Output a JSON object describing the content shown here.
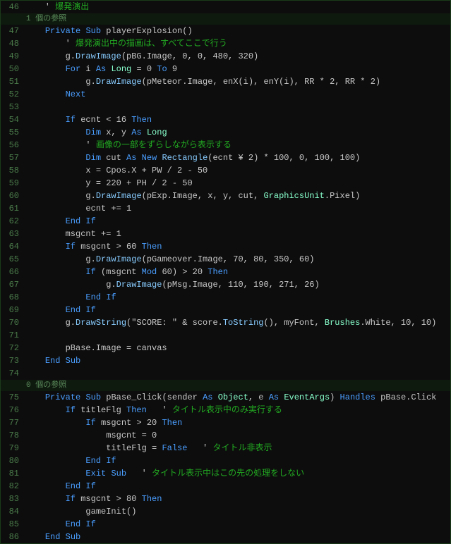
{
  "lines": [
    {
      "num": "46",
      "type": "code",
      "tokens": [
        {
          "t": "    ' ",
          "c": "plain"
        },
        {
          "t": "爆発演出",
          "c": "comment"
        }
      ]
    },
    {
      "num": "",
      "type": "ref",
      "text": "1 個の参照"
    },
    {
      "num": "47",
      "type": "code",
      "tokens": [
        {
          "t": "    ",
          "c": "plain"
        },
        {
          "t": "Private",
          "c": "kw"
        },
        {
          "t": " ",
          "c": "plain"
        },
        {
          "t": "Sub",
          "c": "kw"
        },
        {
          "t": " playerExplosion()",
          "c": "plain"
        }
      ]
    },
    {
      "num": "48",
      "type": "code",
      "tokens": [
        {
          "t": "        ' ",
          "c": "plain"
        },
        {
          "t": "爆発演出中の描画は、すべてここで行う",
          "c": "comment"
        }
      ]
    },
    {
      "num": "49",
      "type": "code",
      "tokens": [
        {
          "t": "        g.",
          "c": "plain"
        },
        {
          "t": "DrawImage",
          "c": "func"
        },
        {
          "t": "(pBG.Image, 0, 0, 480, 320)",
          "c": "plain"
        }
      ]
    },
    {
      "num": "50",
      "type": "code",
      "tokens": [
        {
          "t": "        ",
          "c": "plain"
        },
        {
          "t": "For",
          "c": "kw"
        },
        {
          "t": " i ",
          "c": "plain"
        },
        {
          "t": "As",
          "c": "kw"
        },
        {
          "t": " ",
          "c": "plain"
        },
        {
          "t": "Long",
          "c": "type"
        },
        {
          "t": " = 0 ",
          "c": "plain"
        },
        {
          "t": "To",
          "c": "kw"
        },
        {
          "t": " 9",
          "c": "plain"
        }
      ]
    },
    {
      "num": "51",
      "type": "code",
      "tokens": [
        {
          "t": "            g.",
          "c": "plain"
        },
        {
          "t": "DrawImage",
          "c": "func"
        },
        {
          "t": "(pMeteor.Image, enX(i), enY(i), RR * 2, RR * 2)",
          "c": "plain"
        }
      ]
    },
    {
      "num": "52",
      "type": "code",
      "tokens": [
        {
          "t": "        ",
          "c": "plain"
        },
        {
          "t": "Next",
          "c": "kw"
        }
      ]
    },
    {
      "num": "53",
      "type": "code",
      "tokens": []
    },
    {
      "num": "54",
      "type": "code",
      "tokens": [
        {
          "t": "        ",
          "c": "plain"
        },
        {
          "t": "If",
          "c": "kw"
        },
        {
          "t": " ecnt < 16 ",
          "c": "plain"
        },
        {
          "t": "Then",
          "c": "kw"
        }
      ]
    },
    {
      "num": "55",
      "type": "code",
      "tokens": [
        {
          "t": "            ",
          "c": "plain"
        },
        {
          "t": "Dim",
          "c": "kw"
        },
        {
          "t": " x, y ",
          "c": "plain"
        },
        {
          "t": "As",
          "c": "kw"
        },
        {
          "t": " ",
          "c": "plain"
        },
        {
          "t": "Long",
          "c": "type"
        }
      ]
    },
    {
      "num": "56",
      "type": "code",
      "tokens": [
        {
          "t": "            ' ",
          "c": "plain"
        },
        {
          "t": "画像の一部をずらしながら表示する",
          "c": "comment"
        }
      ]
    },
    {
      "num": "57",
      "type": "code",
      "tokens": [
        {
          "t": "            ",
          "c": "plain"
        },
        {
          "t": "Dim",
          "c": "kw"
        },
        {
          "t": " cut ",
          "c": "plain"
        },
        {
          "t": "As",
          "c": "kw"
        },
        {
          "t": " ",
          "c": "plain"
        },
        {
          "t": "New",
          "c": "kw"
        },
        {
          "t": " ",
          "c": "plain"
        },
        {
          "t": "Rectangle",
          "c": "func"
        },
        {
          "t": "(ecnt ¥ 2) * 100, 0, 100, 100)",
          "c": "plain"
        }
      ]
    },
    {
      "num": "58",
      "type": "code",
      "tokens": [
        {
          "t": "            x = Cpos.X + PW / 2 - 50",
          "c": "plain"
        }
      ]
    },
    {
      "num": "59",
      "type": "code",
      "tokens": [
        {
          "t": "            y = 220 + PH / 2 - 50",
          "c": "plain"
        }
      ]
    },
    {
      "num": "60",
      "type": "code",
      "tokens": [
        {
          "t": "            g.",
          "c": "plain"
        },
        {
          "t": "DrawImage",
          "c": "func"
        },
        {
          "t": "(pExp.Image, x, y, cut, ",
          "c": "plain"
        },
        {
          "t": "GraphicsUnit",
          "c": "type"
        },
        {
          "t": ".Pixel)",
          "c": "plain"
        }
      ]
    },
    {
      "num": "61",
      "type": "code",
      "tokens": [
        {
          "t": "            ecnt += 1",
          "c": "plain"
        }
      ]
    },
    {
      "num": "62",
      "type": "code",
      "tokens": [
        {
          "t": "        ",
          "c": "plain"
        },
        {
          "t": "End",
          "c": "kw"
        },
        {
          "t": " ",
          "c": "plain"
        },
        {
          "t": "If",
          "c": "kw"
        }
      ]
    },
    {
      "num": "63",
      "type": "code",
      "tokens": [
        {
          "t": "        msgcnt += 1",
          "c": "plain"
        }
      ]
    },
    {
      "num": "64",
      "type": "code",
      "tokens": [
        {
          "t": "        ",
          "c": "plain"
        },
        {
          "t": "If",
          "c": "kw"
        },
        {
          "t": " msgcnt > 60 ",
          "c": "plain"
        },
        {
          "t": "Then",
          "c": "kw"
        }
      ]
    },
    {
      "num": "65",
      "type": "code",
      "tokens": [
        {
          "t": "            g.",
          "c": "plain"
        },
        {
          "t": "DrawImage",
          "c": "func"
        },
        {
          "t": "(pGameover.Image, 70, 80, 350, 60)",
          "c": "plain"
        }
      ]
    },
    {
      "num": "66",
      "type": "code",
      "tokens": [
        {
          "t": "            ",
          "c": "plain"
        },
        {
          "t": "If",
          "c": "kw"
        },
        {
          "t": " (msgcnt ",
          "c": "plain"
        },
        {
          "t": "Mod",
          "c": "kw"
        },
        {
          "t": " 60) > 20 ",
          "c": "plain"
        },
        {
          "t": "Then",
          "c": "kw"
        }
      ]
    },
    {
      "num": "67",
      "type": "code",
      "tokens": [
        {
          "t": "                g.",
          "c": "plain"
        },
        {
          "t": "DrawImage",
          "c": "func"
        },
        {
          "t": "(pMsg.Image, 110, 190, 271, 26)",
          "c": "plain"
        }
      ]
    },
    {
      "num": "68",
      "type": "code",
      "tokens": [
        {
          "t": "            ",
          "c": "plain"
        },
        {
          "t": "End",
          "c": "kw"
        },
        {
          "t": " ",
          "c": "plain"
        },
        {
          "t": "If",
          "c": "kw"
        }
      ]
    },
    {
      "num": "69",
      "type": "code",
      "tokens": [
        {
          "t": "        ",
          "c": "plain"
        },
        {
          "t": "End",
          "c": "kw"
        },
        {
          "t": " ",
          "c": "plain"
        },
        {
          "t": "If",
          "c": "kw"
        }
      ]
    },
    {
      "num": "70",
      "type": "code",
      "tokens": [
        {
          "t": "        g.",
          "c": "plain"
        },
        {
          "t": "DrawString",
          "c": "func"
        },
        {
          "t": "(\"SCORE: \" & score.",
          "c": "plain"
        },
        {
          "t": "ToString",
          "c": "func"
        },
        {
          "t": "(), myFont, ",
          "c": "plain"
        },
        {
          "t": "Brushes",
          "c": "type"
        },
        {
          "t": ".White, 10, 10)",
          "c": "plain"
        }
      ]
    },
    {
      "num": "71",
      "type": "code",
      "tokens": []
    },
    {
      "num": "72",
      "type": "code",
      "tokens": [
        {
          "t": "        pBase.Image = canvas",
          "c": "plain"
        }
      ]
    },
    {
      "num": "73",
      "type": "code",
      "tokens": [
        {
          "t": "    ",
          "c": "plain"
        },
        {
          "t": "End",
          "c": "kw"
        },
        {
          "t": " ",
          "c": "plain"
        },
        {
          "t": "Sub",
          "c": "kw"
        }
      ]
    },
    {
      "num": "74",
      "type": "code",
      "tokens": []
    },
    {
      "num": "",
      "type": "ref",
      "text": "0 個の参照"
    },
    {
      "num": "75",
      "type": "code",
      "tokens": [
        {
          "t": "    ",
          "c": "plain"
        },
        {
          "t": "Private",
          "c": "kw"
        },
        {
          "t": " ",
          "c": "plain"
        },
        {
          "t": "Sub",
          "c": "kw"
        },
        {
          "t": " pBase_Click(sender ",
          "c": "plain"
        },
        {
          "t": "As",
          "c": "kw"
        },
        {
          "t": " ",
          "c": "plain"
        },
        {
          "t": "Object",
          "c": "type"
        },
        {
          "t": ", e ",
          "c": "plain"
        },
        {
          "t": "As",
          "c": "kw"
        },
        {
          "t": " ",
          "c": "plain"
        },
        {
          "t": "EventArgs",
          "c": "type"
        },
        {
          "t": ") ",
          "c": "plain"
        },
        {
          "t": "Handles",
          "c": "kw"
        },
        {
          "t": " pBase.Click",
          "c": "plain"
        }
      ]
    },
    {
      "num": "76",
      "type": "code",
      "tokens": [
        {
          "t": "        ",
          "c": "plain"
        },
        {
          "t": "If",
          "c": "kw"
        },
        {
          "t": " titleFlg ",
          "c": "plain"
        },
        {
          "t": "Then",
          "c": "kw"
        },
        {
          "t": "   ' ",
          "c": "plain"
        },
        {
          "t": "タイトル表示中のみ実行する",
          "c": "comment"
        }
      ]
    },
    {
      "num": "77",
      "type": "code",
      "tokens": [
        {
          "t": "            ",
          "c": "plain"
        },
        {
          "t": "If",
          "c": "kw"
        },
        {
          "t": " msgcnt > 20 ",
          "c": "plain"
        },
        {
          "t": "Then",
          "c": "kw"
        }
      ]
    },
    {
      "num": "78",
      "type": "code",
      "tokens": [
        {
          "t": "                msgcnt = 0",
          "c": "plain"
        }
      ]
    },
    {
      "num": "79",
      "type": "code",
      "tokens": [
        {
          "t": "                titleFlg = ",
          "c": "plain"
        },
        {
          "t": "False",
          "c": "kw"
        },
        {
          "t": "   ' ",
          "c": "plain"
        },
        {
          "t": "タイトル非表示",
          "c": "comment"
        }
      ]
    },
    {
      "num": "80",
      "type": "code",
      "tokens": [
        {
          "t": "            ",
          "c": "plain"
        },
        {
          "t": "End",
          "c": "kw"
        },
        {
          "t": " ",
          "c": "plain"
        },
        {
          "t": "If",
          "c": "kw"
        }
      ]
    },
    {
      "num": "81",
      "type": "code",
      "tokens": [
        {
          "t": "            ",
          "c": "plain"
        },
        {
          "t": "Exit",
          "c": "kw"
        },
        {
          "t": " ",
          "c": "plain"
        },
        {
          "t": "Sub",
          "c": "kw"
        },
        {
          "t": "   ' ",
          "c": "plain"
        },
        {
          "t": "タイトル表示中はこの先の処理をしない",
          "c": "comment"
        }
      ]
    },
    {
      "num": "82",
      "type": "code",
      "tokens": [
        {
          "t": "        ",
          "c": "plain"
        },
        {
          "t": "End",
          "c": "kw"
        },
        {
          "t": " ",
          "c": "plain"
        },
        {
          "t": "If",
          "c": "kw"
        }
      ]
    },
    {
      "num": "83",
      "type": "code",
      "tokens": [
        {
          "t": "        ",
          "c": "plain"
        },
        {
          "t": "If",
          "c": "kw"
        },
        {
          "t": " msgcnt > 80 ",
          "c": "plain"
        },
        {
          "t": "Then",
          "c": "kw"
        }
      ]
    },
    {
      "num": "84",
      "type": "code",
      "tokens": [
        {
          "t": "            gameInit()",
          "c": "plain"
        }
      ]
    },
    {
      "num": "85",
      "type": "code",
      "tokens": [
        {
          "t": "        ",
          "c": "plain"
        },
        {
          "t": "End",
          "c": "kw"
        },
        {
          "t": " ",
          "c": "plain"
        },
        {
          "t": "If",
          "c": "kw"
        }
      ]
    },
    {
      "num": "86",
      "type": "code",
      "tokens": [
        {
          "t": "    ",
          "c": "plain"
        },
        {
          "t": "End",
          "c": "kw"
        },
        {
          "t": " ",
          "c": "plain"
        },
        {
          "t": "Sub",
          "c": "kw"
        }
      ]
    }
  ]
}
